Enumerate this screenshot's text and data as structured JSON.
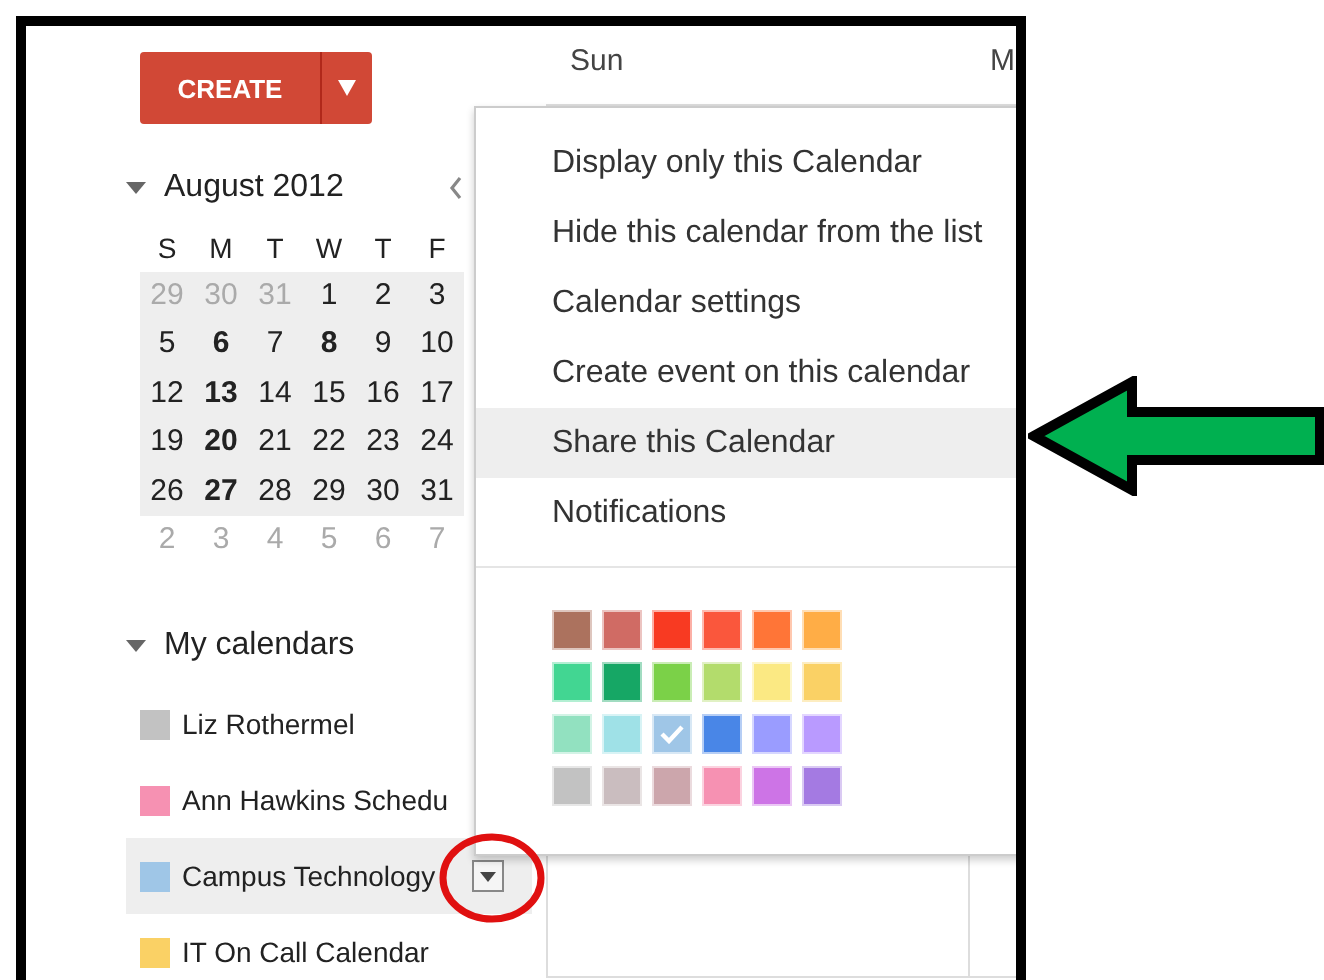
{
  "create_button": {
    "label": "CREATE"
  },
  "mini_calendar": {
    "title": "August 2012",
    "weekdays": [
      "S",
      "M",
      "T",
      "W",
      "T",
      "F"
    ],
    "weeks": [
      {
        "shaded": true,
        "days": [
          {
            "day": "29",
            "muted": true,
            "bold": false
          },
          {
            "day": "30",
            "muted": true,
            "bold": false
          },
          {
            "day": "31",
            "muted": true,
            "bold": false
          },
          {
            "day": "1",
            "muted": false,
            "bold": false
          },
          {
            "day": "2",
            "muted": false,
            "bold": false
          },
          {
            "day": "3",
            "muted": false,
            "bold": false
          }
        ]
      },
      {
        "shaded": true,
        "days": [
          {
            "day": "5",
            "muted": false,
            "bold": false
          },
          {
            "day": "6",
            "muted": false,
            "bold": true
          },
          {
            "day": "7",
            "muted": false,
            "bold": false
          },
          {
            "day": "8",
            "muted": false,
            "bold": true
          },
          {
            "day": "9",
            "muted": false,
            "bold": false
          },
          {
            "day": "10",
            "muted": false,
            "bold": false
          }
        ]
      },
      {
        "shaded": true,
        "days": [
          {
            "day": "12",
            "muted": false,
            "bold": false
          },
          {
            "day": "13",
            "muted": false,
            "bold": true
          },
          {
            "day": "14",
            "muted": false,
            "bold": false
          },
          {
            "day": "15",
            "muted": false,
            "bold": false
          },
          {
            "day": "16",
            "muted": false,
            "bold": false
          },
          {
            "day": "17",
            "muted": false,
            "bold": false
          }
        ]
      },
      {
        "shaded": true,
        "days": [
          {
            "day": "19",
            "muted": false,
            "bold": false
          },
          {
            "day": "20",
            "muted": false,
            "bold": true
          },
          {
            "day": "21",
            "muted": false,
            "bold": false
          },
          {
            "day": "22",
            "muted": false,
            "bold": false
          },
          {
            "day": "23",
            "muted": false,
            "bold": false
          },
          {
            "day": "24",
            "muted": false,
            "bold": false
          }
        ]
      },
      {
        "shaded": true,
        "days": [
          {
            "day": "26",
            "muted": false,
            "bold": false
          },
          {
            "day": "27",
            "muted": false,
            "bold": true
          },
          {
            "day": "28",
            "muted": false,
            "bold": false
          },
          {
            "day": "29",
            "muted": false,
            "bold": false
          },
          {
            "day": "30",
            "muted": false,
            "bold": false
          },
          {
            "day": "31",
            "muted": false,
            "bold": false
          }
        ]
      },
      {
        "shaded": false,
        "days": [
          {
            "day": "2",
            "muted": true,
            "bold": false
          },
          {
            "day": "3",
            "muted": true,
            "bold": false
          },
          {
            "day": "4",
            "muted": true,
            "bold": false
          },
          {
            "day": "5",
            "muted": true,
            "bold": false
          },
          {
            "day": "6",
            "muted": true,
            "bold": false
          },
          {
            "day": "7",
            "muted": true,
            "bold": false
          }
        ]
      }
    ]
  },
  "my_calendars": {
    "title": "My calendars",
    "items": [
      {
        "name": "Liz Rothermel",
        "color": "#c2c2c2",
        "selected": false
      },
      {
        "name": "Ann Hawkins Schedu",
        "color": "#f691b2",
        "selected": false
      },
      {
        "name": "Campus Technology",
        "color": "#9fc6e7",
        "selected": true
      },
      {
        "name": "IT On Call Calendar",
        "color": "#fad165",
        "selected": false
      }
    ]
  },
  "main": {
    "columns": [
      "Sun",
      "M"
    ]
  },
  "menu": {
    "items": [
      {
        "label": "Display only this Calendar",
        "selected": false
      },
      {
        "label": "Hide this calendar from the list",
        "selected": false
      },
      {
        "label": "Calendar settings",
        "selected": false
      },
      {
        "label": "Create event on this calendar",
        "selected": false
      },
      {
        "label": "Share this Calendar",
        "selected": true
      },
      {
        "label": "Notifications",
        "selected": false
      }
    ],
    "colors": [
      {
        "color": "#ac725e",
        "selected": false
      },
      {
        "color": "#d06b64",
        "selected": false
      },
      {
        "color": "#f83a22",
        "selected": false
      },
      {
        "color": "#fa573c",
        "selected": false
      },
      {
        "color": "#ff7537",
        "selected": false
      },
      {
        "color": "#ffad46",
        "selected": false
      },
      {
        "color": "#42d692",
        "selected": false
      },
      {
        "color": "#16a765",
        "selected": false
      },
      {
        "color": "#7bd148",
        "selected": false
      },
      {
        "color": "#b3dc6c",
        "selected": false
      },
      {
        "color": "#fbe983",
        "selected": false
      },
      {
        "color": "#fad165",
        "selected": false
      },
      {
        "color": "#92e1c0",
        "selected": false
      },
      {
        "color": "#9fe1e7",
        "selected": false
      },
      {
        "color": "#9fc6e7",
        "selected": true
      },
      {
        "color": "#4986e7",
        "selected": false
      },
      {
        "color": "#9a9cff",
        "selected": false
      },
      {
        "color": "#b99aff",
        "selected": false
      },
      {
        "color": "#c2c2c2",
        "selected": false
      },
      {
        "color": "#cabdbf",
        "selected": false
      },
      {
        "color": "#cca6ac",
        "selected": false
      },
      {
        "color": "#f691b2",
        "selected": false
      },
      {
        "color": "#cd74e6",
        "selected": false
      },
      {
        "color": "#a47ae2",
        "selected": false
      }
    ]
  }
}
